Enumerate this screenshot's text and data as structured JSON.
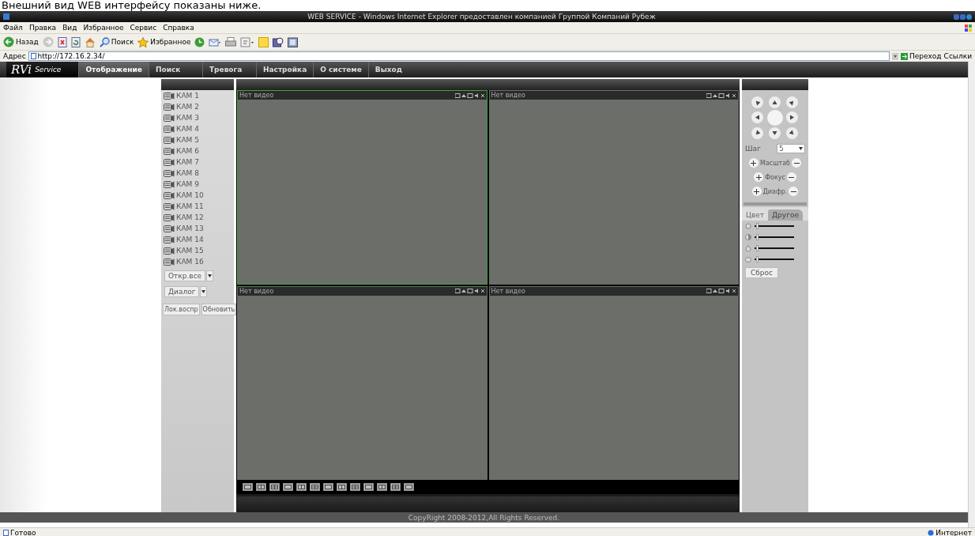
{
  "caption": "Внешний вид WEB интерфейсу показаны ниже.",
  "window": {
    "title": "WEB SERVICE - Windows Internet Explorer предоставлен компанией Группой Компаний Рубеж"
  },
  "menu": [
    "Файл",
    "Правка",
    "Вид",
    "Избранное",
    "Сервис",
    "Справка"
  ],
  "toolbar": [
    {
      "kind": "back",
      "label": "Назад"
    },
    {
      "kind": "forward"
    },
    {
      "kind": "stop"
    },
    {
      "kind": "refresh"
    },
    {
      "kind": "home"
    },
    {
      "kind": "search",
      "label": "Поиск"
    },
    {
      "kind": "favorites",
      "label": "Избранное"
    },
    {
      "kind": "history"
    },
    {
      "kind": "mail"
    },
    {
      "kind": "print"
    },
    {
      "kind": "edit"
    },
    {
      "kind": "note"
    },
    {
      "kind": "media"
    },
    {
      "kind": "tools"
    }
  ],
  "address": {
    "label": "Адрес",
    "value": "http://172.16.2.34/",
    "go": "Переход",
    "links": "Ссылки"
  },
  "app": {
    "logo": "RVi",
    "logo_sub": "Service",
    "tabs": [
      {
        "label": "Отображение",
        "selected": true
      },
      {
        "label": "Поиск",
        "selected": false
      },
      {
        "label": "Тревога",
        "selected": false
      },
      {
        "label": "Настройка",
        "selected": false
      },
      {
        "label": "О системе",
        "selected": false
      },
      {
        "label": "Выход",
        "selected": false
      }
    ],
    "cameras": [
      "КАМ 1",
      "КАМ 2",
      "КАМ 3",
      "КАМ 4",
      "КАМ 5",
      "КАМ 6",
      "КАМ 7",
      "КАМ 8",
      "КАМ 9",
      "КАМ 10",
      "КАМ 11",
      "КАМ 12",
      "КАМ 13",
      "КАМ 14",
      "КАМ 15",
      "КАМ 16"
    ],
    "dropdowns": [
      "Откр.все",
      "Диалог"
    ],
    "buttons": [
      "Лок.воспр",
      "Обновить"
    ],
    "panes": [
      {
        "label": "Нет видео",
        "selected": true
      },
      {
        "label": "Нет видео",
        "selected": false
      },
      {
        "label": "Нет видео",
        "selected": false
      },
      {
        "label": "Нет видео",
        "selected": false
      }
    ],
    "ptz": {
      "step_label": "Шаг",
      "step": "5",
      "controls": [
        "Масштаб",
        "Фокус",
        "Диафр."
      ],
      "tabs": [
        {
          "label": "Цвет",
          "selected": false
        },
        {
          "label": "Другое",
          "selected": true
        }
      ],
      "sliders": [
        {
          "kind": "brightness",
          "level": 0.05
        },
        {
          "kind": "contrast",
          "level": 0.05
        },
        {
          "kind": "saturation",
          "level": 0.05
        },
        {
          "kind": "hue",
          "level": 0.05
        }
      ],
      "reset": "Сброс"
    },
    "copyright": "CopyRight 2008-2012,All Rights Reserved."
  },
  "status": {
    "text": "Готово",
    "zone": "Интернет"
  }
}
